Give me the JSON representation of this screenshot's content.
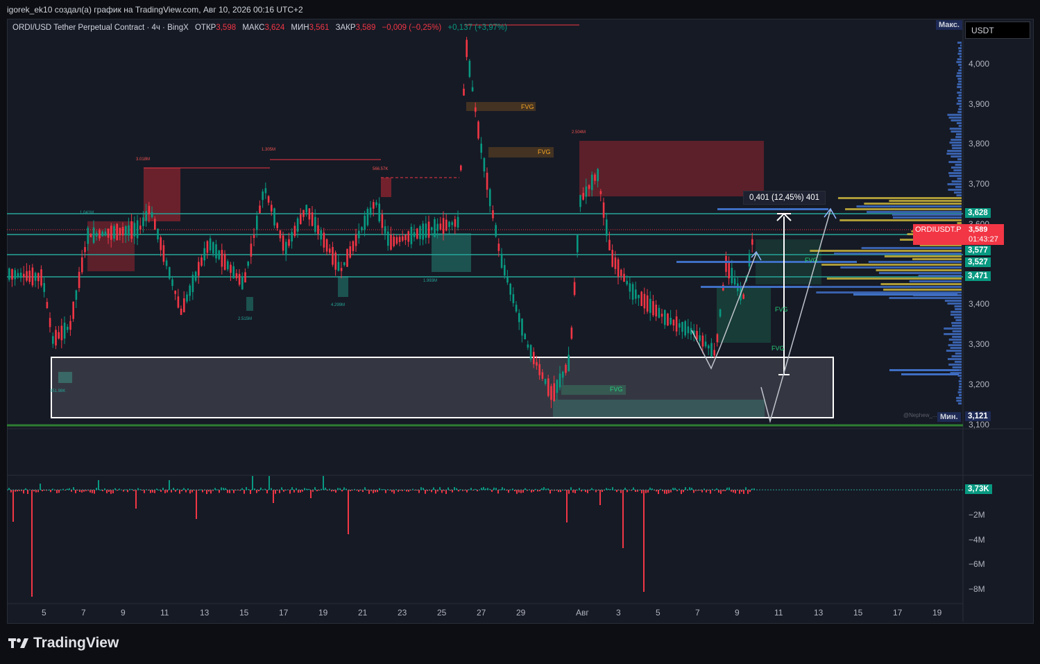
{
  "header": {
    "caption": "igorek_ek10 создал(а) график на TradingView.com, Авг 10, 2026 00:16 UTC+2"
  },
  "legend": {
    "symbol": "ORDI/USD Tether Perpetual Contract · 4ч · BingX",
    "open_label": "ОТКР",
    "open": "3,598",
    "high_label": "МАКС",
    "high": "3,624",
    "low_label": "МИН",
    "low": "3,561",
    "close_label": "ЗАКР",
    "close": "3,589",
    "change": "−0,009 (−0,25%)",
    "change2": "+0,137 (+3,97%)"
  },
  "toolbar": {
    "currency": "USDT"
  },
  "price_axis": {
    "labels": [
      "4,000",
      "3,900",
      "3,800",
      "3,700",
      "3,600",
      "3,400",
      "3,300",
      "3,200",
      "3,100"
    ],
    "max_label": "Макс.",
    "min_label": "Мин.",
    "min_value": "3,121",
    "level_tags": [
      "3,628",
      "3,577",
      "3,527",
      "3,471"
    ]
  },
  "ticker": {
    "name": "ORDIUSDT.P",
    "price": "3,589",
    "countdown": "01:43:27"
  },
  "measure": {
    "text": "0,401 (12,45%) 401"
  },
  "volume_axis": {
    "current": "3,73K",
    "labels": [
      "−2M",
      "−4M",
      "−6M",
      "−8M"
    ]
  },
  "date_axis": [
    "5",
    "7",
    "9",
    "11",
    "13",
    "15",
    "17",
    "19",
    "21",
    "23",
    "25",
    "27",
    "29",
    "Авг",
    "3",
    "5",
    "7",
    "9",
    "11",
    "13",
    "15",
    "17",
    "19"
  ],
  "annotations": {
    "fvg_labels": [
      "FVG",
      "FVG",
      "FVG",
      "FVG",
      "FVG",
      "FVG"
    ],
    "volume_tags": [
      "3.018M",
      "1.305M",
      "566.57K",
      "2.504M",
      "1.041M",
      "1.993M",
      "4.299M",
      "2.515M",
      "351.98K"
    ],
    "watermark": "@Nephew_..."
  },
  "colors": {
    "up": "#089981",
    "down": "#f23645",
    "level": "#26a69a",
    "zone_red": "#b22833",
    "zone_teal": "#1f6b63"
  },
  "branding": {
    "logo_text": "TradingView"
  }
}
